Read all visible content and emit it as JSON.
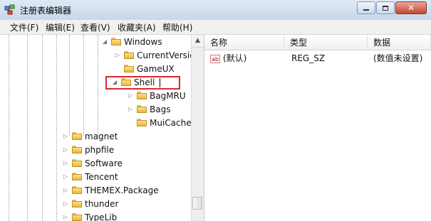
{
  "window": {
    "title": "注册表编辑器"
  },
  "menu": [
    "文件(F)",
    "编辑(E)",
    "查看(V)",
    "收藏夹(A)",
    "帮助(H)"
  ],
  "tree": {
    "items": [
      {
        "label": "Windows",
        "expander": "◢"
      },
      {
        "label": "CurrentVersic",
        "expander": "▷"
      },
      {
        "label": "GameUX",
        "expander": ""
      },
      {
        "label": "Shell",
        "expander": "◢"
      },
      {
        "label": "BagMRU",
        "expander": "▷"
      },
      {
        "label": "Bags",
        "expander": "▷"
      },
      {
        "label": "MuiCache",
        "expander": ""
      },
      {
        "label": "magnet",
        "expander": "▷"
      },
      {
        "label": "phpfile",
        "expander": "▷"
      },
      {
        "label": "Software",
        "expander": "▷"
      },
      {
        "label": "Tencent",
        "expander": "▷"
      },
      {
        "label": "THEMEX.Package",
        "expander": "▷"
      },
      {
        "label": "thunder",
        "expander": "▷"
      },
      {
        "label": "TypeLib",
        "expander": "▷"
      }
    ]
  },
  "list": {
    "headers": [
      "名称",
      "类型",
      "数据"
    ],
    "rows": [
      {
        "name": "(默认)",
        "type": "REG_SZ",
        "data": "(数值未设置)"
      }
    ]
  },
  "icons": {
    "value_icon": "ab",
    "scroll_up": "▲"
  }
}
